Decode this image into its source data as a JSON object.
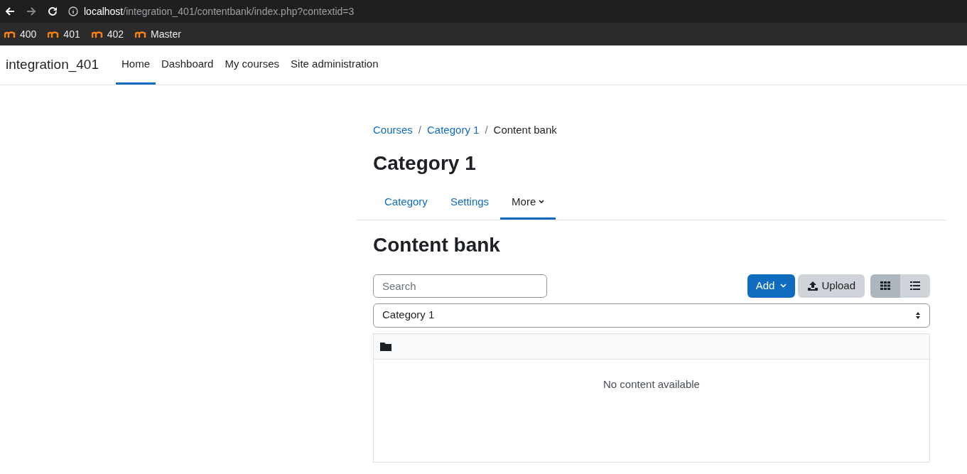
{
  "browser": {
    "url_host": "localhost",
    "url_path": "/integration_401/contentbank/index.php?contextid=3",
    "bookmarks": [
      {
        "label": "400"
      },
      {
        "label": "401"
      },
      {
        "label": "402"
      },
      {
        "label": "Master"
      }
    ]
  },
  "navbar": {
    "site_name": "integration_401",
    "items": [
      {
        "label": "Home",
        "selected": true
      },
      {
        "label": "Dashboard",
        "selected": false
      },
      {
        "label": "My courses",
        "selected": false
      },
      {
        "label": "Site administration",
        "selected": false
      }
    ]
  },
  "breadcrumb": [
    {
      "label": "Courses",
      "link": true
    },
    {
      "label": "Category 1",
      "link": true
    },
    {
      "label": "Content bank",
      "link": false
    }
  ],
  "breadcrumb_separator": "/",
  "page_title": "Category 1",
  "secondary_nav": [
    {
      "label": "Category",
      "selected": false,
      "dropdown": false
    },
    {
      "label": "Settings",
      "selected": false,
      "dropdown": false
    },
    {
      "label": "More",
      "selected": true,
      "dropdown": true
    }
  ],
  "section_title": "Content bank",
  "search": {
    "placeholder": "Search"
  },
  "add_button": "Add",
  "upload_button": "Upload",
  "views": [
    {
      "kind": "grid",
      "selected": true
    },
    {
      "kind": "list",
      "selected": false
    }
  ],
  "context_select": {
    "value": "Category 1"
  },
  "empty_message": "No content available"
}
